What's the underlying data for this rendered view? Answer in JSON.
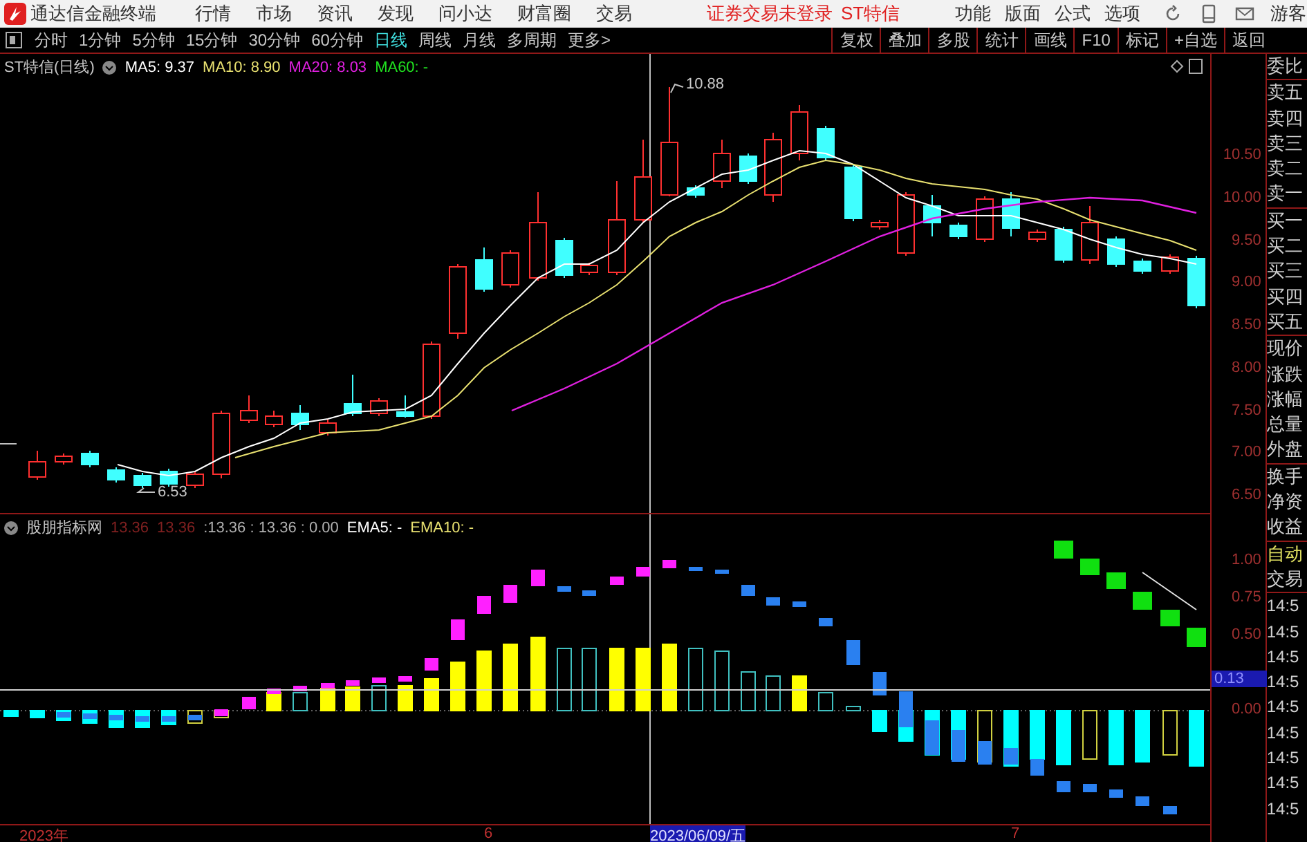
{
  "menubar": {
    "app_title": "通达信金融终端",
    "menus": [
      "行情",
      "市场",
      "资讯",
      "发现",
      "问小达",
      "财富圈",
      "交易"
    ],
    "login_status": "证券交易未登录",
    "stock_name": "ST特信",
    "tools": [
      "功能",
      "版面",
      "公式",
      "选项"
    ],
    "user": "游客"
  },
  "period_tabs": [
    {
      "label": "分时",
      "selected": false
    },
    {
      "label": "1分钟",
      "selected": false
    },
    {
      "label": "5分钟",
      "selected": false
    },
    {
      "label": "15分钟",
      "selected": false
    },
    {
      "label": "30分钟",
      "selected": false
    },
    {
      "label": "60分钟",
      "selected": false
    },
    {
      "label": "日线",
      "selected": true
    },
    {
      "label": "周线",
      "selected": false
    },
    {
      "label": "月线",
      "selected": false
    },
    {
      "label": "多周期",
      "selected": false
    },
    {
      "label": "更多>",
      "selected": false
    }
  ],
  "chart_buttons": [
    "复权",
    "叠加",
    "多股",
    "统计",
    "画线",
    "F10",
    "标记",
    "+自选",
    "返回"
  ],
  "main_chart": {
    "title": "ST特信(日线)",
    "indicators": [
      {
        "label": "MA5: 9.37",
        "color": "#ffffff"
      },
      {
        "label": "MA10: 8.90",
        "color": "#e8e070"
      },
      {
        "label": "MA20: 8.03",
        "color": "#e020e0"
      },
      {
        "label": "MA60: -",
        "color": "#20e020"
      }
    ],
    "high_label": "10.88",
    "low_label": "6.53",
    "price_ticks": [
      "10.50",
      "10.00",
      "9.50",
      "9.00",
      "8.50",
      "8.00",
      "7.50",
      "7.00",
      "6.50"
    ]
  },
  "sub_chart": {
    "title": "股朋指标网",
    "values": [
      {
        "label": "13.36",
        "kind": "dim"
      },
      {
        "label": "13.36",
        "kind": "dim"
      },
      {
        "label": ":13.36 : 13.36 : 0.00",
        "kind": "plain"
      },
      {
        "label": "EMA5: -",
        "kind": "white"
      },
      {
        "label": "EMA10: -",
        "kind": "yellow"
      }
    ],
    "ticks": [
      "1.00",
      "0.75",
      "0.50",
      "0.00"
    ],
    "cursor_readout": "0.13"
  },
  "date_axis": [
    {
      "label": "2023年",
      "kind": "tick"
    },
    {
      "label": "6",
      "kind": "tick"
    },
    {
      "label": "2023/06/09/五",
      "kind": "cursor"
    },
    {
      "label": "7",
      "kind": "tick"
    }
  ],
  "side_panel": {
    "quote_groups": [
      [
        "委比"
      ],
      [
        "卖五",
        "卖四",
        "卖三",
        "卖二",
        "卖一"
      ],
      [
        "买一",
        "买二",
        "买三",
        "买四",
        "买五"
      ],
      [
        "现价",
        "涨跌",
        "涨幅",
        "总量",
        "外盘"
      ],
      [
        "换手",
        "净资",
        "收益"
      ]
    ],
    "auto_trade": "自动",
    "trade_label": "交易",
    "times": [
      "14:5",
      "14:5",
      "14:5",
      "14:5",
      "14:5",
      "14:5",
      "14:5",
      "14:5",
      "14:5"
    ]
  }
}
